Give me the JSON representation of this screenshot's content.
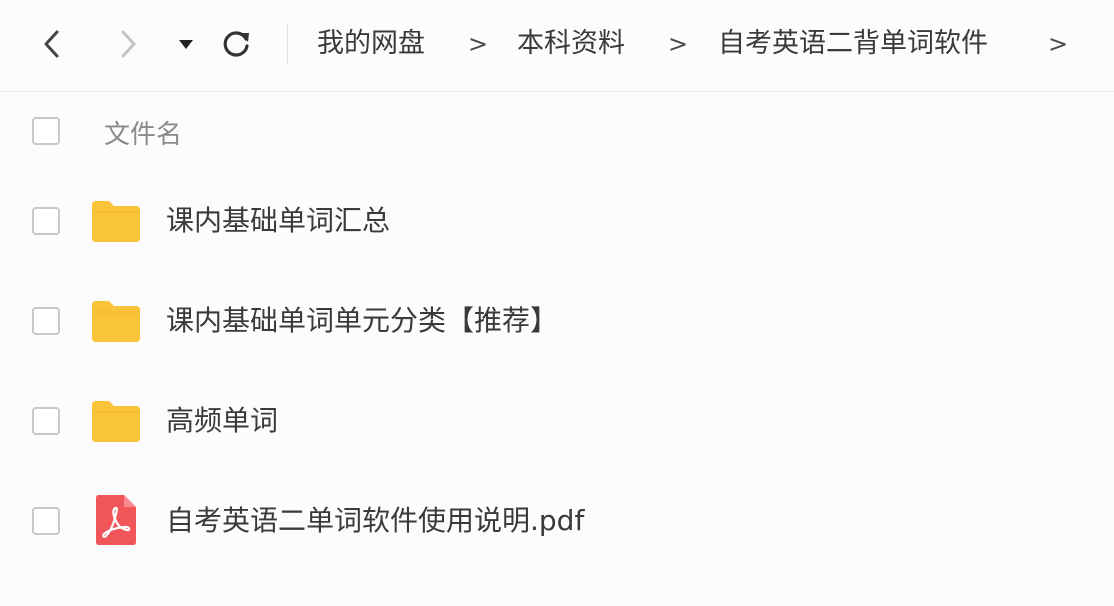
{
  "breadcrumb": [
    {
      "label": "我的网盘"
    },
    {
      "label": "本科资料"
    },
    {
      "label": "自考英语二背单词软件"
    }
  ],
  "breadcrumb_separator": ">",
  "list_header": {
    "name_label": "文件名"
  },
  "files": [
    {
      "name": "课内基础单词汇总",
      "type": "folder"
    },
    {
      "name": "课内基础单词单元分类【推荐】",
      "type": "folder"
    },
    {
      "name": "高频单词",
      "type": "folder"
    },
    {
      "name": "自考英语二单词软件使用说明.pdf",
      "type": "pdf"
    }
  ],
  "colors": {
    "folder": "#f9c43a",
    "pdf": "#f0555a",
    "icon": "#444444",
    "icon_disabled": "#c4c4c4"
  },
  "icons": {
    "back": "chevron-left-icon",
    "forward": "chevron-right-icon",
    "dropdown": "caret-down-icon",
    "refresh": "refresh-icon",
    "folder": "folder-icon",
    "pdf": "pdf-file-icon"
  }
}
